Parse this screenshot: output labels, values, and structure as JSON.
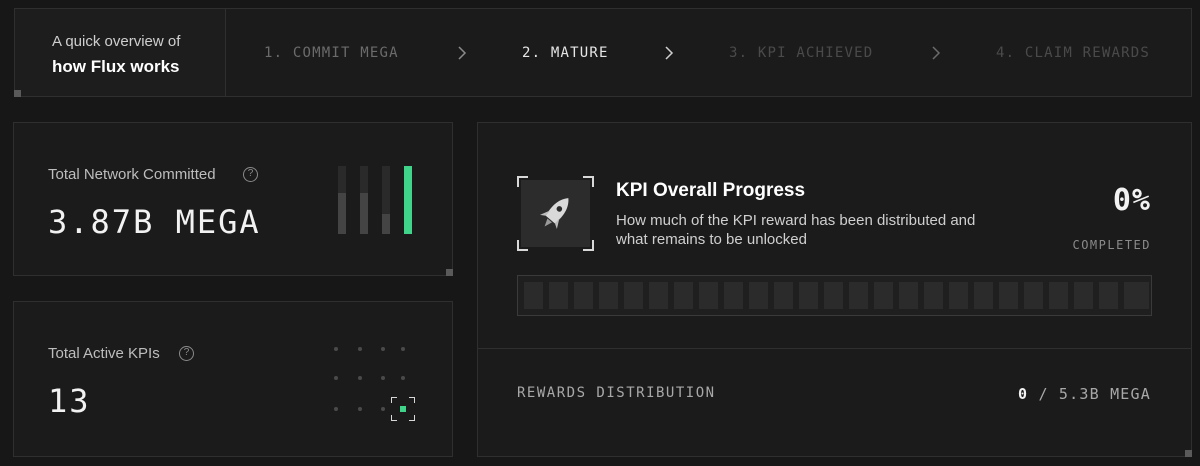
{
  "intro": {
    "line1": "A quick overview of",
    "line2": "how Flux works"
  },
  "steps": [
    {
      "label": "1. COMMIT MEGA",
      "state": "done"
    },
    {
      "label": "2. MATURE",
      "state": "active"
    },
    {
      "label": "3. KPI ACHIEVED",
      "state": "pending"
    },
    {
      "label": "4. CLAIM REWARDS",
      "state": "pending"
    }
  ],
  "stats": {
    "committed": {
      "label": "Total Network Committed",
      "value": "3.87B MEGA",
      "help_icon": "question-circle-icon",
      "bar_levels": [
        0.6,
        0.6,
        0.3,
        1.0
      ],
      "highlight_color": "#3fd48a"
    },
    "kpis": {
      "label": "Total Active KPIs",
      "value": "13",
      "help_icon": "question-circle-icon"
    }
  },
  "kpi": {
    "title": "KPI Overall Progress",
    "description": "How much of the KPI reward has been distributed and what remains to be unlocked",
    "icon": "rocket-icon",
    "percent": "0%",
    "percent_label": "COMPLETED",
    "progress": 0,
    "segments": 25,
    "rewards_label": "REWARDS DISTRIBUTION",
    "rewards_distributed": "0",
    "rewards_total": "/ 5.3B MEGA"
  },
  "colors": {
    "accent": "#3fd48a",
    "background": "#171717",
    "panel": "#1b1b1b"
  }
}
